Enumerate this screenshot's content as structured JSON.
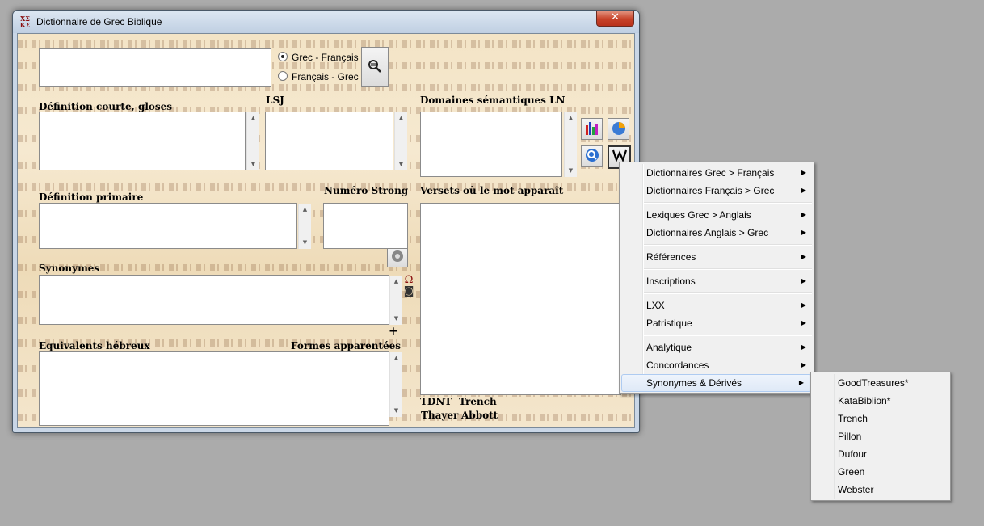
{
  "window": {
    "title": "Dictionnaire de Grec Biblique",
    "icon_text": "ΧΣ ΚΣ",
    "close_label": "✕"
  },
  "search": {
    "value": "",
    "radio_grec_fr": "Grec - Français",
    "radio_fr_grec": "Français - Grec",
    "selected": "Grec - Français"
  },
  "labels": {
    "def_courte": "Définition courte, gloses",
    "lsj": "LSJ",
    "domaines": "Domaines sémantiques LN",
    "def_primaire": "Définition primaire",
    "numero_strong": "Numéro Strong",
    "versets": "Versets où le mot apparaît",
    "synonymes": "Synonymes",
    "plus": "+",
    "equivalents": "Equivalents hébreux",
    "formes": "Formes apparentées",
    "tdnt": "TDNT",
    "trench": "Trench",
    "thayer": "Thayer",
    "abbott": "Abbott"
  },
  "context_menu": {
    "items": [
      {
        "label": "Dictionnaires Grec > Français"
      },
      {
        "label": "Dictionnaires Français > Grec"
      },
      {
        "label": "Lexiques Grec > Anglais"
      },
      {
        "label": "Dictionnaires Anglais > Grec"
      },
      {
        "label": "Références"
      },
      {
        "label": "Inscriptions"
      },
      {
        "label": "LXX"
      },
      {
        "label": "Patristique"
      },
      {
        "label": "Analytique"
      },
      {
        "label": "Concordances"
      },
      {
        "label": "Synonymes & Dérivés",
        "highlighted": true
      }
    ]
  },
  "submenu": {
    "items": [
      "GoodTreasures*",
      "KataBiblion*",
      "Trench",
      "Pillon",
      "Dufour",
      "Green",
      "Webster"
    ]
  },
  "colors": {
    "highlight": "#dfe9f7",
    "close_button": "#c7432a"
  }
}
